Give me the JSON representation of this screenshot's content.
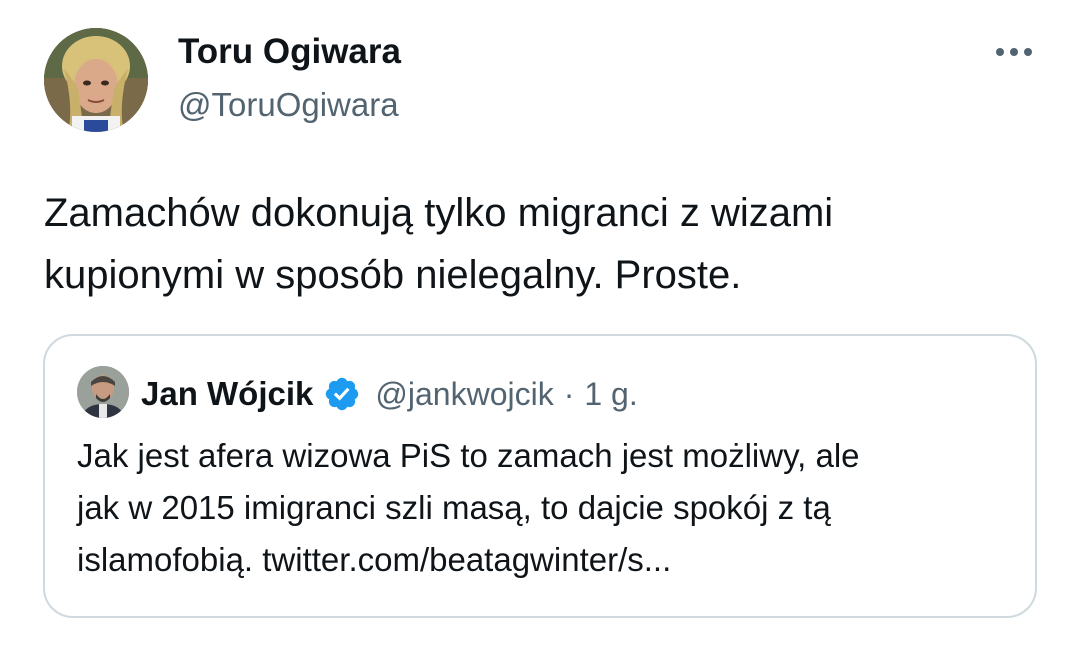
{
  "author": {
    "name": "Toru Ogiwara",
    "handle": "@ToruOgiwara"
  },
  "tweet": {
    "lines": [
      "Zamachów dokonują tylko migranci z wizami",
      "kupionymi w sposób nielegalny. Proste."
    ]
  },
  "quoted": {
    "name": "Jan Wójcik",
    "handle": "@jankwojcik",
    "separator": "·",
    "time": "1 g.",
    "lines": [
      "Jak jest afera wizowa PiS to zamach jest możliwy, ale",
      "jak w 2015 imigranci szli masą, to dajcie spokój z tą",
      "islamofobią. twitter.com/beatagwinter/s..."
    ]
  },
  "colors": {
    "text": "#0f1419",
    "secondary": "#536471",
    "border": "#cfd9de",
    "verified": "#1d9bf0"
  },
  "icons": {
    "more": "more-horizontal-icon",
    "verified": "verified-badge-icon"
  }
}
